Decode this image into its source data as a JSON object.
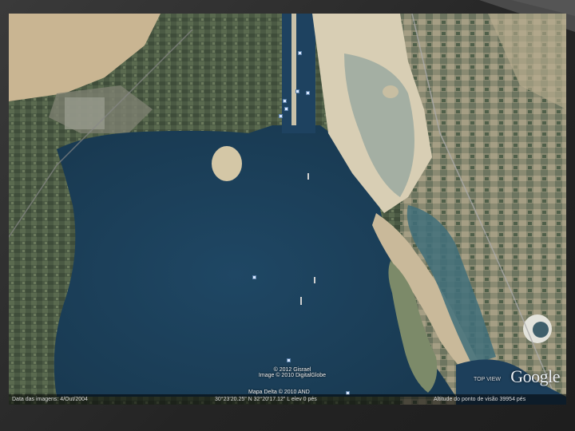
{
  "status_bar": {
    "imagery_date": "Data das imagens: 4/Out/2004",
    "coordinates": "30°23'20.25\" N    32°20'17.12\" L    elev    0 pés",
    "eye_altitude": "Altitude do ponto de visão    39954 pés"
  },
  "attribution": {
    "line1": "© 2012 Gisrael",
    "line2": "Image © 2010 DigitalGlobe",
    "line3": "Mapa Delta © 2010 AND"
  },
  "logo": {
    "brand": "Google",
    "tagline": "TOP VIEW"
  },
  "colors": {
    "water": "#1d3f5b",
    "desert": "#cdbf9e",
    "farmland": "#4a5a45"
  }
}
